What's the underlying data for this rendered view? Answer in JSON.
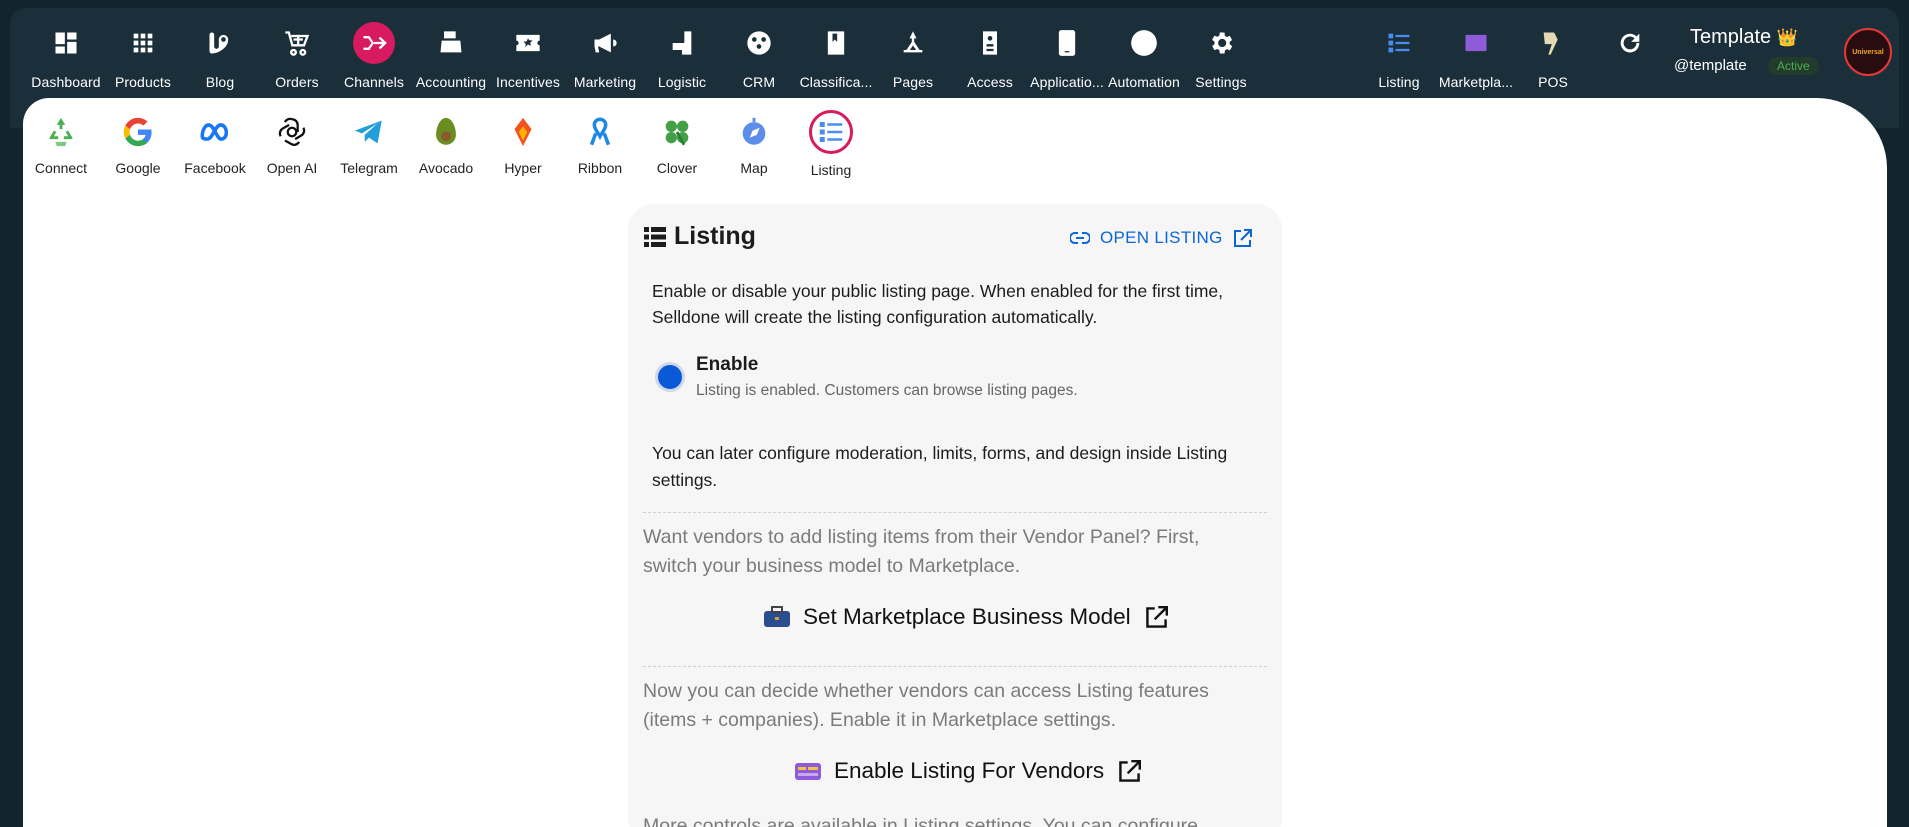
{
  "nav": {
    "left": [
      {
        "label": "Dashboard",
        "icon": "dashboard-icon"
      },
      {
        "label": "Products",
        "icon": "grid-icon"
      },
      {
        "label": "Blog",
        "icon": "blog-icon"
      },
      {
        "label": "Orders",
        "icon": "cart-icon"
      },
      {
        "label": "Channels",
        "icon": "channels-icon"
      },
      {
        "label": "Accounting",
        "icon": "register-icon"
      },
      {
        "label": "Incentives",
        "icon": "ticket-icon"
      },
      {
        "label": "Marketing",
        "icon": "megaphone-icon"
      },
      {
        "label": "Logistic",
        "icon": "truck-icon"
      },
      {
        "label": "CRM",
        "icon": "crm-icon"
      },
      {
        "label": "Classifica...",
        "icon": "book-icon"
      },
      {
        "label": "Pages",
        "icon": "pen-icon"
      },
      {
        "label": "Access",
        "icon": "badge-icon"
      },
      {
        "label": "Applicatio...",
        "icon": "phone-icon"
      },
      {
        "label": "Automation",
        "icon": "bolt-icon"
      },
      {
        "label": "Settings",
        "icon": "gear-icon"
      }
    ],
    "right": [
      {
        "label": "Listing",
        "icon": "listing-icon"
      },
      {
        "label": "Marketpla...",
        "icon": "marketplace-icon"
      },
      {
        "label": "POS",
        "icon": "pos-icon"
      }
    ],
    "refresh_icon": "refresh-icon",
    "active": "Channels",
    "active_color": "#d81b60"
  },
  "profile": {
    "name": "Template",
    "crown": "👑",
    "handle": "@template",
    "status": "Active",
    "avatar_text": "Universal"
  },
  "channels": [
    {
      "label": "Connect",
      "icon": "recycle-icon"
    },
    {
      "label": "Google",
      "icon": "google-icon"
    },
    {
      "label": "Facebook",
      "icon": "meta-icon"
    },
    {
      "label": "Open AI",
      "icon": "openai-icon"
    },
    {
      "label": "Telegram",
      "icon": "telegram-icon"
    },
    {
      "label": "Avocado",
      "icon": "avocado-icon"
    },
    {
      "label": "Hyper",
      "icon": "hyper-icon"
    },
    {
      "label": "Ribbon",
      "icon": "ribbon-icon"
    },
    {
      "label": "Clover",
      "icon": "clover-icon"
    },
    {
      "label": "Map",
      "icon": "map-icon"
    },
    {
      "label": "Listing",
      "icon": "listing-icon"
    }
  ],
  "card": {
    "title": "Listing",
    "open_link": "OPEN LISTING",
    "description": "Enable or disable your public listing page. When enabled for the first time, Selldone will create the listing configuration automatically.",
    "enable_title": "Enable",
    "enable_sub": "Listing is enabled. Customers can browse listing pages.",
    "later_note": "You can later configure moderation, limits, forms, and design inside Listing settings.",
    "vendors_note": "Want vendors to add listing items from their Vendor Panel? First, switch your business model to Marketplace.",
    "set_marketplace": "Set Marketplace Business Model",
    "access_note": "Now you can decide whether vendors can access Listing features (items + companies). Enable it in Marketplace settings.",
    "enable_vendors": "Enable Listing For Vendors",
    "more_note": "More controls are available in Listing settings. You can configure"
  },
  "colors": {
    "accent_blue": "#0b66d6",
    "radio_blue": "#0a5ad8",
    "status_green": "#4caf50",
    "topbar": "#1b2f3a"
  }
}
